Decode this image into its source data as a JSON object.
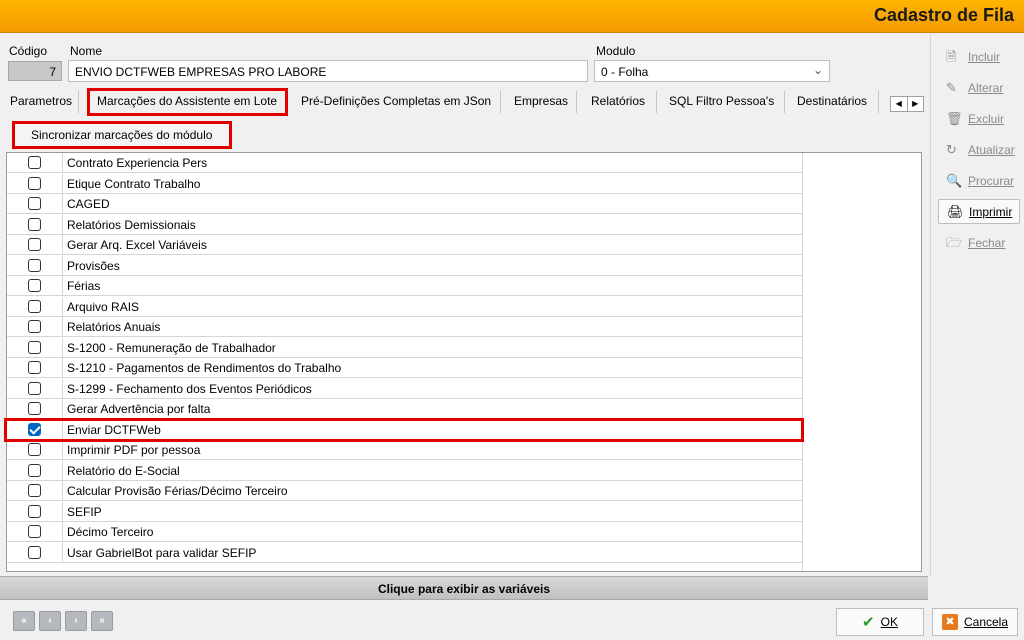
{
  "window": {
    "title": "Cadastro de Fila"
  },
  "header": {
    "codigo_label": "Código",
    "codigo_value": "7",
    "nome_label": "Nome",
    "nome_value": "ENVIO DCTFWEB EMPRESAS PRO LABORE",
    "modulo_label": "Modulo",
    "modulo_value": "0 - Folha"
  },
  "tabs": [
    {
      "label": "Parametros"
    },
    {
      "label": "Marcações do Assistente em Lote",
      "active": true
    },
    {
      "label": "Pré-Definições Completas em JSon"
    },
    {
      "label": "Empresas"
    },
    {
      "label": "Relatórios"
    },
    {
      "label": "SQL Filtro Pessoa's"
    },
    {
      "label": "Destinatários"
    }
  ],
  "sync_button": {
    "label": "Sincronizar marcações do módulo"
  },
  "items": [
    {
      "label": "Contrato Experiencia Pers",
      "checked": false
    },
    {
      "label": "Etique Contrato Trabalho",
      "checked": false
    },
    {
      "label": "CAGED",
      "checked": false
    },
    {
      "label": "Relatórios Demissionais",
      "checked": false
    },
    {
      "label": "Gerar Arq. Excel Variáveis",
      "checked": false
    },
    {
      "label": "Provisões",
      "checked": false
    },
    {
      "label": "Férias",
      "checked": false
    },
    {
      "label": "Arquivo RAIS",
      "checked": false
    },
    {
      "label": "Relatórios Anuais",
      "checked": false
    },
    {
      "label": "S-1200 - Remuneração de Trabalhador",
      "checked": false
    },
    {
      "label": "S-1210 - Pagamentos de Rendimentos do Trabalho",
      "checked": false
    },
    {
      "label": "S-1299 - Fechamento dos Eventos Periódicos",
      "checked": false
    },
    {
      "label": "Gerar Advertência por falta",
      "checked": false
    },
    {
      "label": "Enviar DCTFWeb",
      "checked": true
    },
    {
      "label": "Imprimir PDF por pessoa",
      "checked": false
    },
    {
      "label": "Relatório do E-Social",
      "checked": false
    },
    {
      "label": "Calcular Provisão Férias/Décimo Terceiro",
      "checked": false
    },
    {
      "label": "SEFIP",
      "checked": false
    },
    {
      "label": "Décimo Terceiro",
      "checked": false
    },
    {
      "label": "Usar GabrielBot para validar SEFIP",
      "checked": false
    }
  ],
  "variables_bar": {
    "label": "Clique para exibir as variáveis"
  },
  "toolbar": [
    {
      "label": "Incluir",
      "icon": "new-document-icon",
      "enabled": false
    },
    {
      "label": "Alterar",
      "icon": "edit-icon",
      "enabled": false
    },
    {
      "label": "Excluir",
      "icon": "trash-icon",
      "enabled": false
    },
    {
      "label": "Atualizar",
      "icon": "refresh-icon",
      "enabled": false
    },
    {
      "label": "Procurar",
      "icon": "binoculars-icon",
      "enabled": false
    },
    {
      "label": "Imprimir",
      "icon": "printer-icon",
      "enabled": true
    },
    {
      "label": "Fechar",
      "icon": "close-folder-icon",
      "enabled": false
    }
  ],
  "footer": {
    "ok_label": "OK",
    "cancel_label": "Cancela"
  },
  "colors": {
    "titlebar": "#f5a300",
    "highlight": "#e00000",
    "checkbox": "#0067c0"
  }
}
